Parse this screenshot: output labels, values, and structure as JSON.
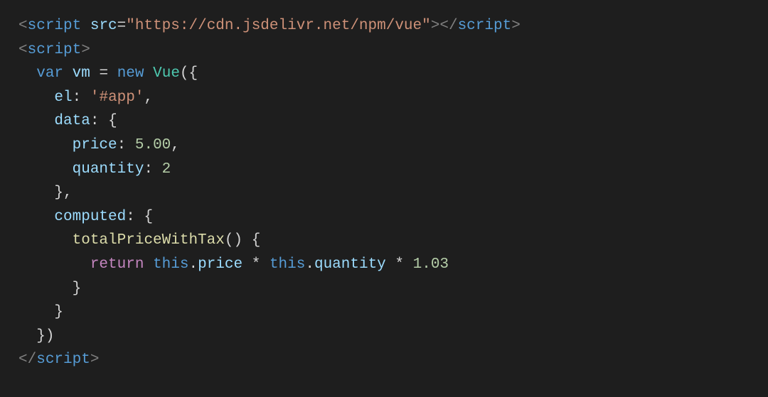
{
  "code": {
    "line1": {
      "open_bracket": "<",
      "tag": "script",
      "attr_name": "src",
      "eq": "=",
      "quote1": "\"",
      "src_value": "https://cdn.jsdelivr.net/npm/vue",
      "quote2": "\"",
      "close_bracket1": ">",
      "open_close_bracket": "</",
      "tag2": "script",
      "close_bracket2": ">"
    },
    "line2": {
      "open_bracket": "<",
      "tag": "script",
      "close_bracket": ">"
    },
    "line3": {
      "indent": "  ",
      "var_kw": "var",
      "sp1": " ",
      "vm": "vm",
      "sp2": " ",
      "eq": "=",
      "sp3": " ",
      "new_kw": "new",
      "sp4": " ",
      "vue": "Vue",
      "paren_brace": "({"
    },
    "line4": {
      "indent": "    ",
      "el": "el",
      "colon": ":",
      "sp1": " ",
      "app": "'#app'",
      "comma": ","
    },
    "line5": {
      "indent": "    ",
      "data": "data",
      "colon": ":",
      "sp1": " ",
      "brace": "{"
    },
    "line6": {
      "indent": "      ",
      "price": "price",
      "colon": ":",
      "sp1": " ",
      "val": "5.00",
      "comma": ","
    },
    "line7": {
      "indent": "      ",
      "quantity": "quantity",
      "colon": ":",
      "sp1": " ",
      "val": "2"
    },
    "line8": {
      "indent": "    ",
      "brace": "}",
      "comma": ","
    },
    "line9": {
      "indent": "    ",
      "computed": "computed",
      "colon": ":",
      "sp1": " ",
      "brace": "{"
    },
    "line10": {
      "indent": "      ",
      "fn": "totalPriceWithTax",
      "parens": "()",
      "sp1": " ",
      "brace": "{"
    },
    "line11": {
      "indent": "        ",
      "return_kw": "return",
      "sp1": " ",
      "this1": "this",
      "dot1": ".",
      "price": "price",
      "sp2": " ",
      "star1": "*",
      "sp3": " ",
      "this2": "this",
      "dot2": ".",
      "quantity": "quantity",
      "sp4": " ",
      "star2": "*",
      "sp5": " ",
      "tax": "1.03"
    },
    "line12": {
      "indent": "      ",
      "brace": "}"
    },
    "line13": {
      "indent": "    ",
      "brace": "}"
    },
    "line14": {
      "indent": "  ",
      "brace_paren": "})"
    },
    "line15": {
      "open_close_bracket": "</",
      "tag": "script",
      "close_bracket": ">"
    }
  }
}
